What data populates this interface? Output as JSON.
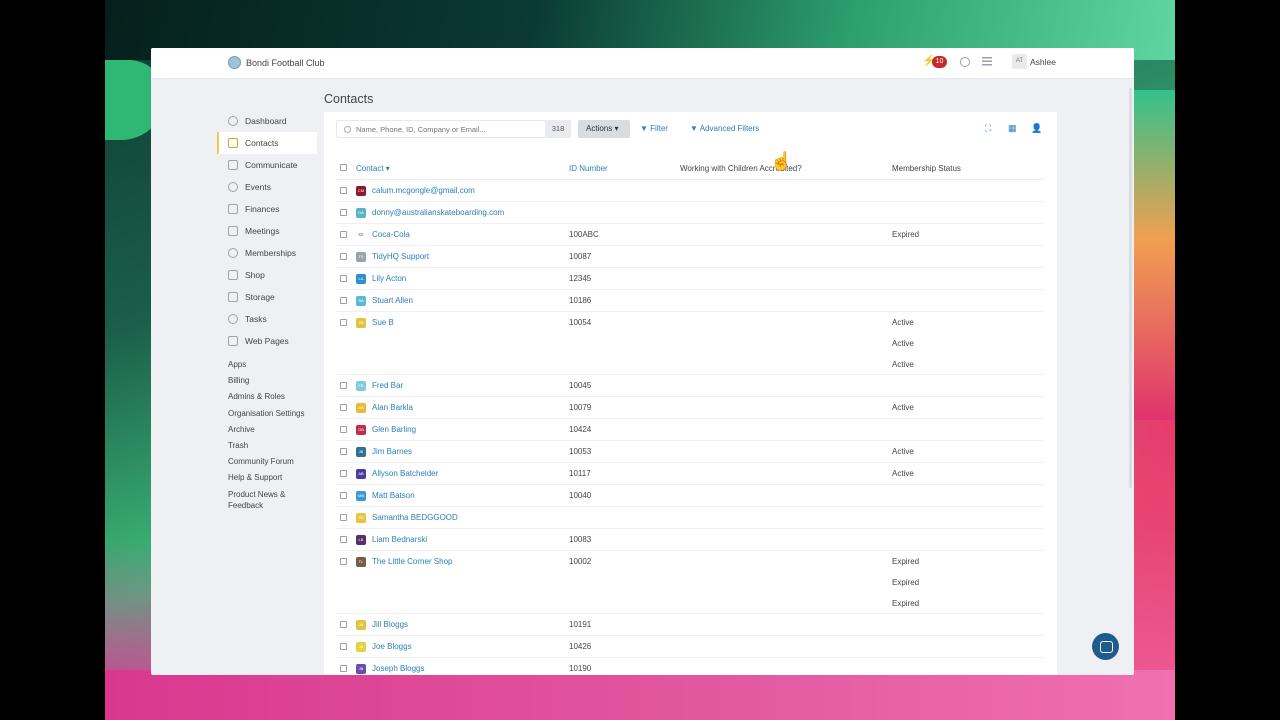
{
  "app": {
    "brand": "Bondi Football Club",
    "notifications": "10",
    "user_initials": "AT",
    "user_name": "Ashlee"
  },
  "sidebar": {
    "items": [
      {
        "label": "Dashboard",
        "icon": "home-icon"
      },
      {
        "label": "Contacts",
        "icon": "contacts-icon",
        "active": true
      },
      {
        "label": "Communicate",
        "icon": "chat-icon"
      },
      {
        "label": "Events",
        "icon": "calendar-icon"
      },
      {
        "label": "Finances",
        "icon": "wallet-icon"
      },
      {
        "label": "Meetings",
        "icon": "meetings-icon"
      },
      {
        "label": "Memberships",
        "icon": "membership-icon"
      },
      {
        "label": "Shop",
        "icon": "cart-icon"
      },
      {
        "label": "Storage",
        "icon": "folder-icon"
      },
      {
        "label": "Tasks",
        "icon": "check-icon"
      },
      {
        "label": "Web Pages",
        "icon": "web-icon"
      }
    ],
    "links": [
      "Apps",
      "Billing",
      "Admins & Roles",
      "Organisation Settings",
      "Archive",
      "Trash",
      "Community Forum",
      "Help & Support",
      "Product News &",
      "Feedback"
    ]
  },
  "page": {
    "title": "Contacts"
  },
  "toolbar": {
    "search_placeholder": "Name, Phone, ID, Company or Email...",
    "count": "318",
    "actions_label": "Actions ▾",
    "filter_label": "Filter",
    "advanced_filters_label": "Advanced Filters"
  },
  "table": {
    "headers": {
      "contact": "Contact ▾",
      "id": "ID Number",
      "wwc": "Working with Children Accredited?",
      "membership": "Membership Status"
    },
    "rows": [
      {
        "name": "calum.mcgongle@gmail.com",
        "id": "",
        "status": [],
        "color": "#8a1b2a",
        "initials": "CM"
      },
      {
        "name": "donny@australianskateboarding.com",
        "id": "",
        "status": [],
        "color": "#5ab2c9",
        "initials": "DA"
      },
      {
        "name": "Coca-Cola",
        "id": "100ABC",
        "status": [
          "Expired"
        ],
        "color": "#ffffff",
        "initials": "cc"
      },
      {
        "name": "TidyHQ Support",
        "id": "10087",
        "status": [],
        "color": "#9aa3ab",
        "initials": "TS"
      },
      {
        "name": "Lily Acton",
        "id": "12345",
        "status": [],
        "color": "#2f8fd1",
        "initials": "LA"
      },
      {
        "name": "Stuart Allen",
        "id": "10186",
        "status": [],
        "color": "#58bcd1",
        "initials": "SA"
      },
      {
        "name": "Sue B",
        "id": "10054",
        "status": [
          "Active",
          "Active",
          "Active"
        ],
        "color": "#e3c23d",
        "initials": "SB"
      },
      {
        "name": "Fred Bar",
        "id": "10045",
        "status": [],
        "color": "#7ccde0",
        "initials": "FB"
      },
      {
        "name": "Alan Barkla",
        "id": "10079",
        "status": [
          "Active"
        ],
        "color": "#f0b73c",
        "initials": "AB"
      },
      {
        "name": "Glen Barling",
        "id": "10424",
        "status": [],
        "color": "#c02d4a",
        "initials": "GB"
      },
      {
        "name": "Jim Barnes",
        "id": "10053",
        "status": [
          "Active"
        ],
        "color": "#2f6f9a",
        "initials": "JB"
      },
      {
        "name": "Allyson Batchelder",
        "id": "10117",
        "status": [
          "Active"
        ],
        "color": "#4a3c9c",
        "initials": "AB"
      },
      {
        "name": "Matt Batson",
        "id": "10040",
        "status": [],
        "color": "#3a9ad9",
        "initials": "MB"
      },
      {
        "name": "Samantha BEDGGOOD",
        "id": "",
        "status": [],
        "color": "#e9c53f",
        "initials": "SB"
      },
      {
        "name": "Liam Bednarski",
        "id": "10083",
        "status": [],
        "color": "#5a2d6a",
        "initials": "LB"
      },
      {
        "name": "The Little Corner Shop",
        "id": "10002",
        "status": [
          "Expired",
          "Expired",
          "Expired"
        ],
        "color": "#7a5a4a",
        "initials": "TL"
      },
      {
        "name": "Jill Bloggs",
        "id": "10191",
        "status": [],
        "color": "#e3c23d",
        "initials": "JB"
      },
      {
        "name": "Joe Bloggs",
        "id": "10426",
        "status": [],
        "color": "#e3d43d",
        "initials": "JB"
      },
      {
        "name": "Joseph Bloggs",
        "id": "10190",
        "status": [],
        "color": "#6a4cb0",
        "initials": "JB"
      }
    ]
  }
}
